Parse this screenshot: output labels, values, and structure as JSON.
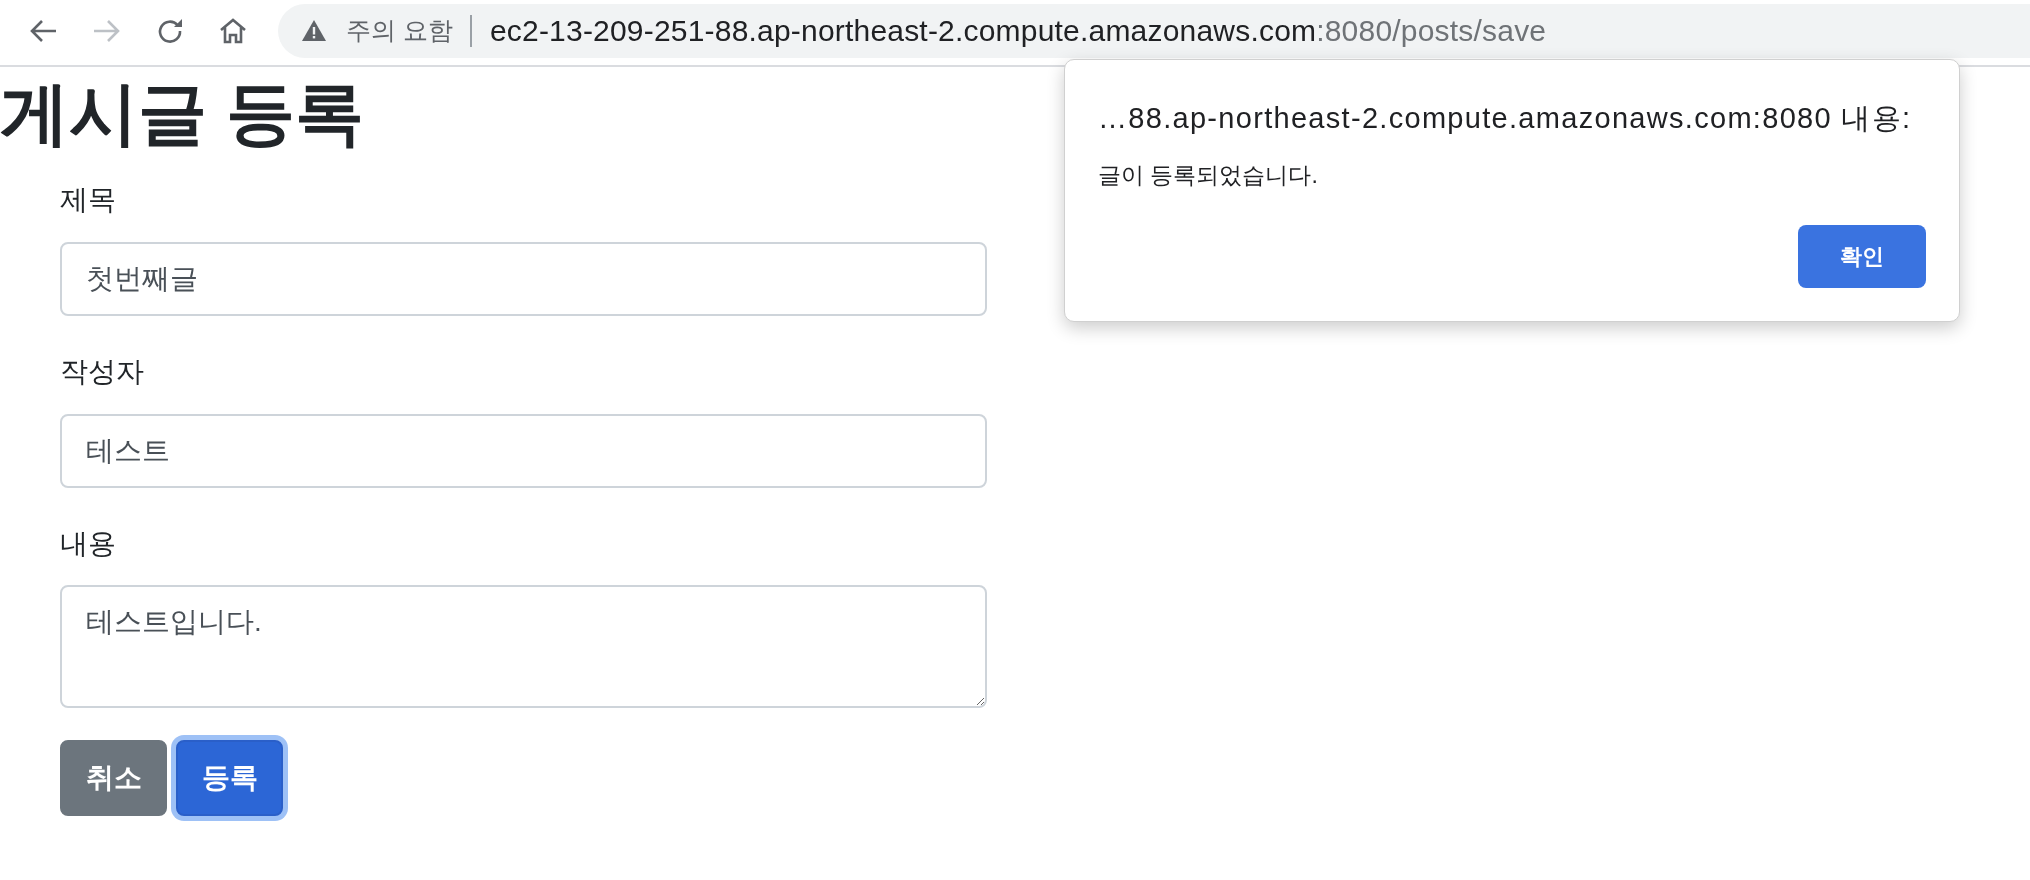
{
  "browser": {
    "nav_buttons": [
      {
        "kind": "back",
        "disabled": false
      },
      {
        "kind": "forward",
        "disabled": true
      },
      {
        "kind": "reload",
        "disabled": false
      },
      {
        "kind": "home",
        "disabled": false
      }
    ],
    "security_label": "주의 요함",
    "url": {
      "host": "ec2-13-209-251-88.ap-northeast-2.compute.amazonaws.com",
      "path": ":8080/posts/save"
    }
  },
  "page": {
    "title": "게시글 등록",
    "fields": [
      {
        "kind": "input",
        "label": "제목",
        "value": "첫번째글"
      },
      {
        "kind": "input",
        "label": "작성자",
        "value": "테스트"
      },
      {
        "kind": "textarea",
        "label": "내용",
        "value": "테스트입니다."
      }
    ],
    "buttons": [
      {
        "kind": "secondary",
        "label": "취소",
        "focused": false
      },
      {
        "kind": "primary",
        "label": "등록",
        "focused": true
      }
    ]
  },
  "dialog": {
    "title": "…88.ap-northeast-2.compute.amazonaws.com:8080 내용:",
    "message": "글이 등록되었습니다.",
    "button": "확인"
  }
}
